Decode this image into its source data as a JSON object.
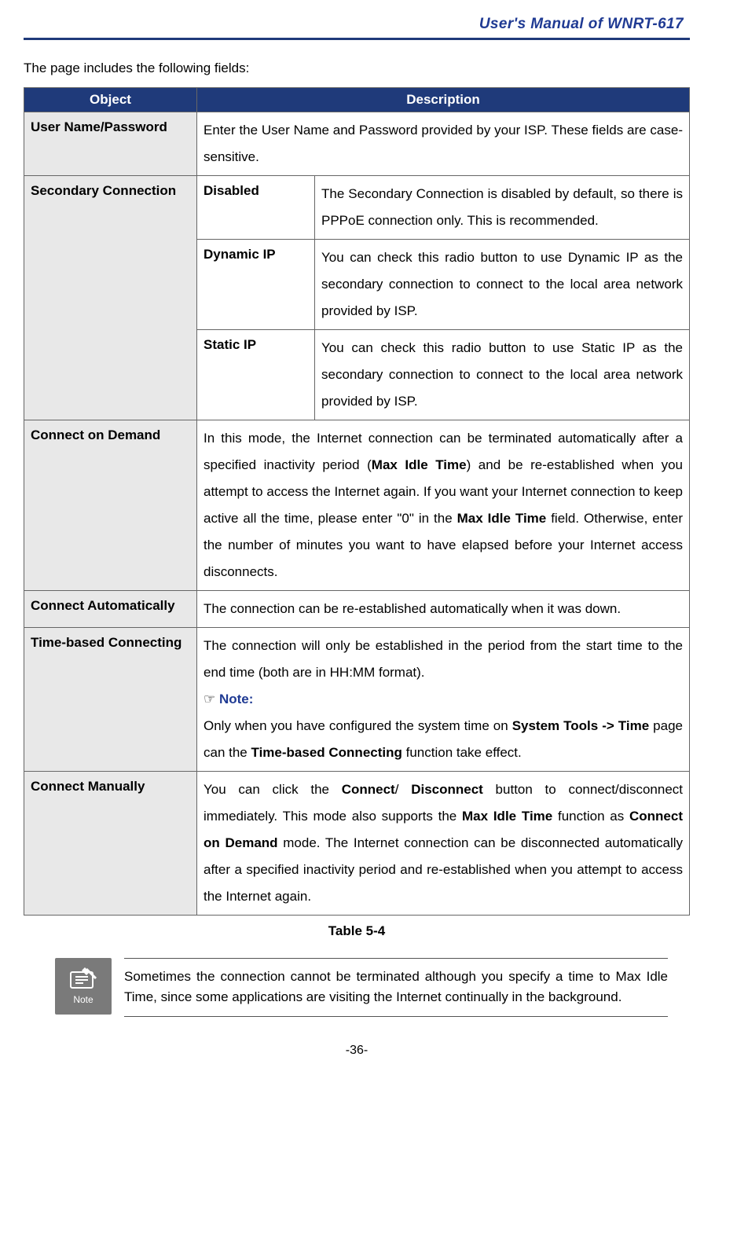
{
  "header": {
    "title": "User's Manual of WNRT-617"
  },
  "intro": "The page includes the following fields:",
  "table_header": {
    "object": "Object",
    "description": "Description"
  },
  "rows": {
    "user_name": {
      "label": "User Name/Password",
      "desc": "Enter the User Name and Password provided by your ISP. These fields are case-sensitive."
    },
    "secondary": {
      "label": "Secondary Connection",
      "disabled": {
        "label": "Disabled",
        "desc": "The Secondary Connection is disabled by default, so there is PPPoE connection only. This is recommended."
      },
      "dynamic": {
        "label": "Dynamic IP",
        "desc": "You can check this radio button to use Dynamic IP as the secondary connection to connect to the local area network provided by ISP."
      },
      "static": {
        "label": "Static IP",
        "desc": "You can check this radio button to use Static IP as the secondary connection to connect to the local area network provided by ISP."
      }
    },
    "connect_on_demand": {
      "label": "Connect on Demand",
      "desc_parts": {
        "p1": "In this mode, the Internet connection can be terminated automatically after a specified inactivity period (",
        "b1": "Max Idle Time",
        "p2": ") and be re-established when you attempt to access the Internet again. If you want your Internet connection to keep active all the time, please enter \"0\" in the ",
        "b2": "Max Idle Time",
        "p3": " field. Otherwise, enter the number of minutes you want to have elapsed before your Internet access disconnects."
      }
    },
    "connect_auto": {
      "label": "Connect Automatically",
      "desc": "The connection can be re-established automatically when it was down."
    },
    "time_based": {
      "label": "Time-based Connecting",
      "desc_parts": {
        "p1": "The connection will only be established in the period from the start time to the end time (both are in HH:MM format).",
        "note_label": "Note:",
        "p2a": "Only when you have configured the system time on ",
        "b1": "System Tools -> Time",
        "p2b": " page can the ",
        "b2": "Time-based Connecting",
        "p2c": " function take effect."
      }
    },
    "connect_manual": {
      "label": "Connect Manually",
      "desc_parts": {
        "p1": "You can click the ",
        "b1": "Connect",
        "slash": "/ ",
        "b2": "Disconnect",
        "p2": " button to connect/disconnect immediately. This mode also supports the ",
        "b3": "Max Idle Time",
        "p3": " function as ",
        "b4": "Connect on Demand",
        "p4": " mode. The Internet connection can be disconnected automatically after a specified inactivity period and re-established when you attempt to access the Internet again."
      }
    }
  },
  "caption": "Table 5-4",
  "note": {
    "icon_label": "Note",
    "text": "Sometimes the connection cannot be terminated although you specify a time to Max Idle Time, since some applications are visiting the Internet continually in the background."
  },
  "footer": "-36-"
}
